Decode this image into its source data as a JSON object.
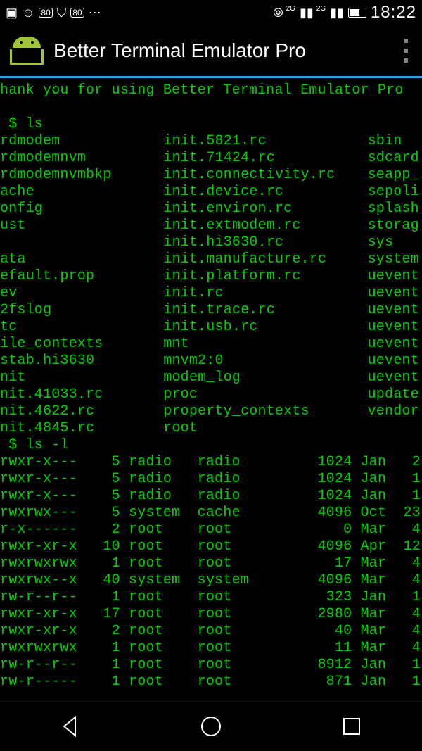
{
  "statusbar": {
    "left_icons": [
      "⎆",
      "🎮",
      "80",
      "⍰",
      "80",
      "⋯"
    ],
    "net_label": "2G",
    "clock": "18:22"
  },
  "app": {
    "title": "Better Terminal Emulator Pro"
  },
  "term": {
    "welcome": "hank you for using Better Terminal Emulator Pro",
    "prompt1": " $ ls",
    "prompt2": " $ ls -l",
    "ls_cols": [
      {
        "c1": "rdmodem",
        "c2": "init.5821.rc",
        "c3": "sbin"
      },
      {
        "c1": "rdmodemnvm",
        "c2": "init.71424.rc",
        "c3": "sdcard"
      },
      {
        "c1": "rdmodemnvmbkp",
        "c2": "init.connectivity.rc",
        "c3": "seapp_"
      },
      {
        "c1": "ache",
        "c2": "init.device.rc",
        "c3": "sepoli"
      },
      {
        "c1": "onfig",
        "c2": "init.environ.rc",
        "c3": "splash"
      },
      {
        "c1": "ust",
        "c2": "init.extmodem.rc",
        "c3": "storag"
      },
      {
        "c1": "",
        "c2": "init.hi3630.rc",
        "c3": "sys"
      },
      {
        "c1": "ata",
        "c2": "init.manufacture.rc",
        "c3": "system"
      },
      {
        "c1": "efault.prop",
        "c2": "init.platform.rc",
        "c3": "uevent"
      },
      {
        "c1": "ev",
        "c2": "init.rc",
        "c3": "uevent"
      },
      {
        "c1": "2fslog",
        "c2": "init.trace.rc",
        "c3": "uevent"
      },
      {
        "c1": "tc",
        "c2": "init.usb.rc",
        "c3": "uevent"
      },
      {
        "c1": "ile_contexts",
        "c2": "mnt",
        "c3": "uevent"
      },
      {
        "c1": "stab.hi3630",
        "c2": "mnvm2:0",
        "c3": "uevent"
      },
      {
        "c1": "nit",
        "c2": "modem_log",
        "c3": "uevent"
      },
      {
        "c1": "nit.41033.rc",
        "c2": "proc",
        "c3": "update"
      },
      {
        "c1": "nit.4622.rc",
        "c2": "property_contexts",
        "c3": "vendor"
      },
      {
        "c1": "nit.4845.rc",
        "c2": "root",
        "c3": ""
      }
    ],
    "lsl": [
      {
        "perm": "rwxr-x---",
        "links": "5",
        "owner": "radio",
        "group": "radio",
        "size": "1024",
        "mon": "Jan",
        "day": "2"
      },
      {
        "perm": "rwxr-x---",
        "links": "5",
        "owner": "radio",
        "group": "radio",
        "size": "1024",
        "mon": "Jan",
        "day": "1"
      },
      {
        "perm": "rwxr-x---",
        "links": "5",
        "owner": "radio",
        "group": "radio",
        "size": "1024",
        "mon": "Jan",
        "day": "1"
      },
      {
        "perm": "rwxrwx---",
        "links": "5",
        "owner": "system",
        "group": "cache",
        "size": "4096",
        "mon": "Oct",
        "day": "23"
      },
      {
        "perm": "r-x------",
        "links": "2",
        "owner": "root",
        "group": "root",
        "size": "0",
        "mon": "Mar",
        "day": "4"
      },
      {
        "perm": "rwxr-xr-x",
        "links": "10",
        "owner": "root",
        "group": "root",
        "size": "4096",
        "mon": "Apr",
        "day": "12"
      },
      {
        "perm": "rwxrwxrwx",
        "links": "1",
        "owner": "root",
        "group": "root",
        "size": "17",
        "mon": "Mar",
        "day": "4"
      },
      {
        "perm": "rwxrwx--x",
        "links": "40",
        "owner": "system",
        "group": "system",
        "size": "4096",
        "mon": "Mar",
        "day": "4"
      },
      {
        "perm": "rw-r--r--",
        "links": "1",
        "owner": "root",
        "group": "root",
        "size": "323",
        "mon": "Jan",
        "day": "1"
      },
      {
        "perm": "rwxr-xr-x",
        "links": "17",
        "owner": "root",
        "group": "root",
        "size": "2980",
        "mon": "Mar",
        "day": "4"
      },
      {
        "perm": "rwxr-xr-x",
        "links": "2",
        "owner": "root",
        "group": "root",
        "size": "40",
        "mon": "Mar",
        "day": "4"
      },
      {
        "perm": "rwxrwxrwx",
        "links": "1",
        "owner": "root",
        "group": "root",
        "size": "11",
        "mon": "Mar",
        "day": "4"
      },
      {
        "perm": "rw-r--r--",
        "links": "1",
        "owner": "root",
        "group": "root",
        "size": "8912",
        "mon": "Jan",
        "day": "1"
      },
      {
        "perm": "rw-r-----",
        "links": "1",
        "owner": "root",
        "group": "root",
        "size": "871",
        "mon": "Jan",
        "day": "1"
      }
    ]
  }
}
